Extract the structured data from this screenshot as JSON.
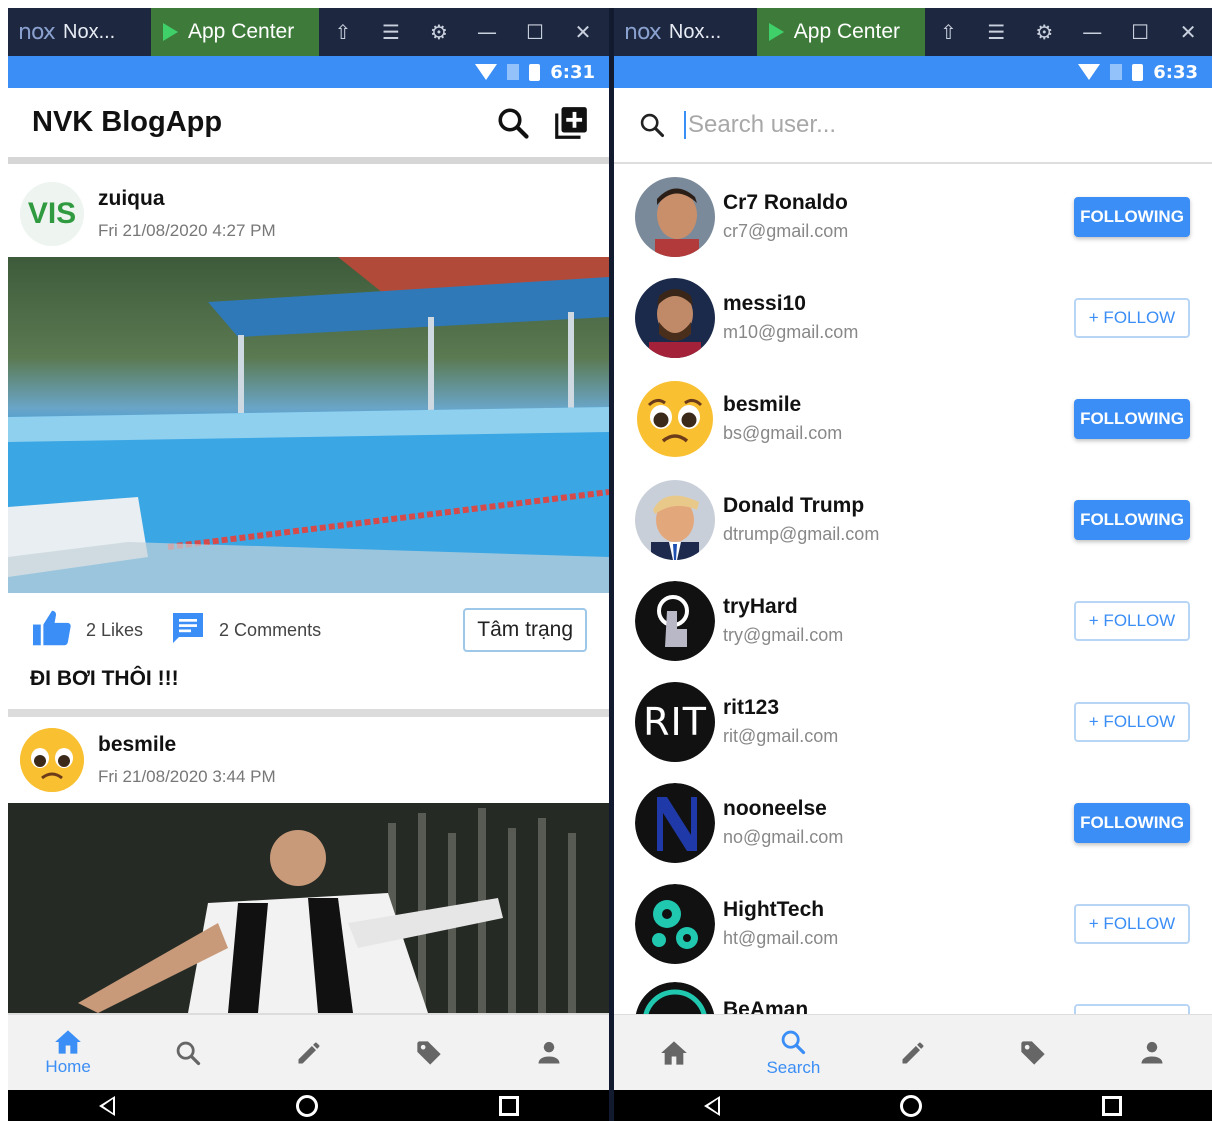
{
  "colors": {
    "accent": "#3b8ef5",
    "titlebar": "#1d2840",
    "appcenter": "#3e7b3a"
  },
  "left": {
    "titlebar": {
      "logo": "nox",
      "name": "Nox...",
      "app_center": "App Center"
    },
    "status": {
      "time": "6:31"
    },
    "header": {
      "title": "NVK BlogApp"
    },
    "posts": [
      {
        "avatar_text": "VIS",
        "user": "zuiqua",
        "time": "Fri 21/08/2020 4:27 PM",
        "likes": "2 Likes",
        "comments": "2 Comments",
        "mood_button": "Tâm trạng",
        "caption": "ĐI BƠI THÔI !!!"
      },
      {
        "user": "besmile",
        "time": "Fri 21/08/2020 3:44 PM"
      }
    ],
    "bottom_nav": {
      "home_label": "Home"
    }
  },
  "right": {
    "titlebar": {
      "logo": "nox",
      "name": "Nox...",
      "app_center": "App Center"
    },
    "status": {
      "time": "6:33"
    },
    "search": {
      "placeholder": "Search user..."
    },
    "users": [
      {
        "name": "Cr7 Ronaldo",
        "email": "cr7@gmail.com",
        "button": "FOLLOWING",
        "following": true
      },
      {
        "name": "messi10",
        "email": "m10@gmail.com",
        "button": "+ FOLLOW",
        "following": false
      },
      {
        "name": "besmile",
        "email": "bs@gmail.com",
        "button": "FOLLOWING",
        "following": true
      },
      {
        "name": "Donald Trump",
        "email": "dtrump@gmail.com",
        "button": "FOLLOWING",
        "following": true
      },
      {
        "name": "tryHard",
        "email": "try@gmail.com",
        "button": "+ FOLLOW",
        "following": false
      },
      {
        "name": "rit123",
        "email": "rit@gmail.com",
        "button": "+ FOLLOW",
        "following": false,
        "avatar_text": "RIT"
      },
      {
        "name": "nooneelse",
        "email": "no@gmail.com",
        "button": "FOLLOWING",
        "following": true
      },
      {
        "name": "HightTech",
        "email": "ht@gmail.com",
        "button": "+ FOLLOW",
        "following": false
      },
      {
        "name": "BeAman",
        "email": "",
        "button": "",
        "following": false
      }
    ],
    "bottom_nav": {
      "search_label": "Search"
    }
  }
}
